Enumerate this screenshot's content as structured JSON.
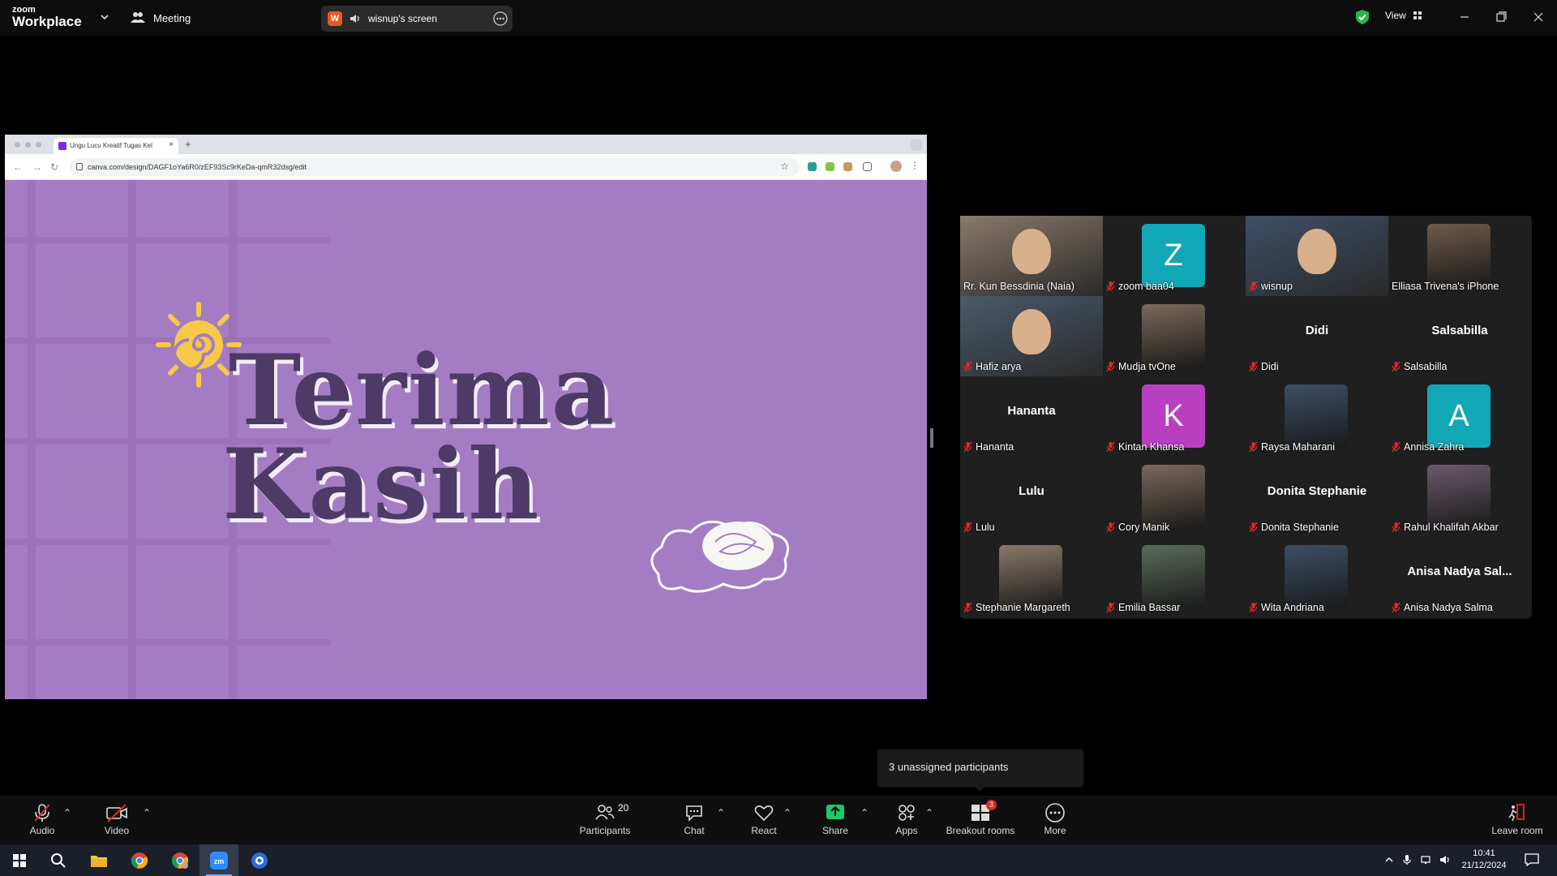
{
  "app": {
    "logo_small": "zoom",
    "logo_big": "Workplace"
  },
  "titlebar": {
    "meeting_label": "Meeting",
    "share_app_badge": "W",
    "share_label": "wisnup's screen",
    "view_label": "View"
  },
  "browser": {
    "tab_title": "Ungu Lucu Kreatif Tugas Kel",
    "url": "canva.com/design/DAGF1oYa6R0/zEF93Sc9rKeDa-qmR32dsg/edit"
  },
  "slide": {
    "line1": "Terima",
    "line2": "Kasih"
  },
  "participants": [
    {
      "name": "Rr. Kun Bessdinia (Naia)",
      "type": "video",
      "active": true,
      "muted": false
    },
    {
      "name": "zoom baa04",
      "type": "avatar",
      "letter": "Z",
      "color": "#12a7b6",
      "muted": true
    },
    {
      "name": "wisnup",
      "type": "video",
      "muted": true
    },
    {
      "name": "Elliasa Trivena's iPhone",
      "type": "photo",
      "muted": false
    },
    {
      "name": "Hafiz arya",
      "type": "video",
      "muted": true
    },
    {
      "name": "Mudja tvOne",
      "type": "photo",
      "muted": true
    },
    {
      "name": "Didi",
      "type": "name",
      "big": "Didi",
      "muted": true
    },
    {
      "name": "Salsabilla",
      "type": "name",
      "big": "Salsabilla",
      "muted": true
    },
    {
      "name": "Hananta",
      "type": "name",
      "big": "Hananta",
      "muted": true
    },
    {
      "name": "Kintan Khansa",
      "type": "avatar",
      "letter": "K",
      "color": "#b83fc0",
      "muted": true
    },
    {
      "name": "Raysa Maharani",
      "type": "photo",
      "muted": true
    },
    {
      "name": "Annisa Zahra",
      "type": "avatar",
      "letter": "A",
      "color": "#12a7b6",
      "muted": true
    },
    {
      "name": "Lulu",
      "type": "name",
      "big": "Lulu",
      "muted": true
    },
    {
      "name": "Cory Manik",
      "type": "photo",
      "muted": true
    },
    {
      "name": "Donita Stephanie",
      "type": "name",
      "big": "Donita Stephanie",
      "muted": true
    },
    {
      "name": "Rahul Khalifah Akbar",
      "type": "photo",
      "muted": true
    },
    {
      "name": "Stephanie Margareth",
      "type": "photo",
      "muted": true
    },
    {
      "name": "Emilia Bassar",
      "type": "photo",
      "muted": true
    },
    {
      "name": "Wita Andriana",
      "type": "photo",
      "muted": true
    },
    {
      "name": "Anisa Nadya Salma",
      "type": "name",
      "big": "Anisa Nadya Sal...",
      "muted": true
    }
  ],
  "popover": {
    "text": "3 unassigned participants"
  },
  "toolbar": {
    "audio": "Audio",
    "video": "Video",
    "participants": "Participants",
    "participants_count": "20",
    "chat": "Chat",
    "react": "React",
    "share": "Share",
    "apps": "Apps",
    "breakout": "Breakout rooms",
    "breakout_badge": "3",
    "more": "More",
    "leave": "Leave room"
  },
  "taskbar": {
    "time": "10:41",
    "date": "21/12/2024"
  },
  "colors": {
    "accent_green": "#27c28e",
    "share_green": "#1cc96b",
    "slide_bg": "#a47cc4",
    "title_text": "#4d3a66"
  }
}
